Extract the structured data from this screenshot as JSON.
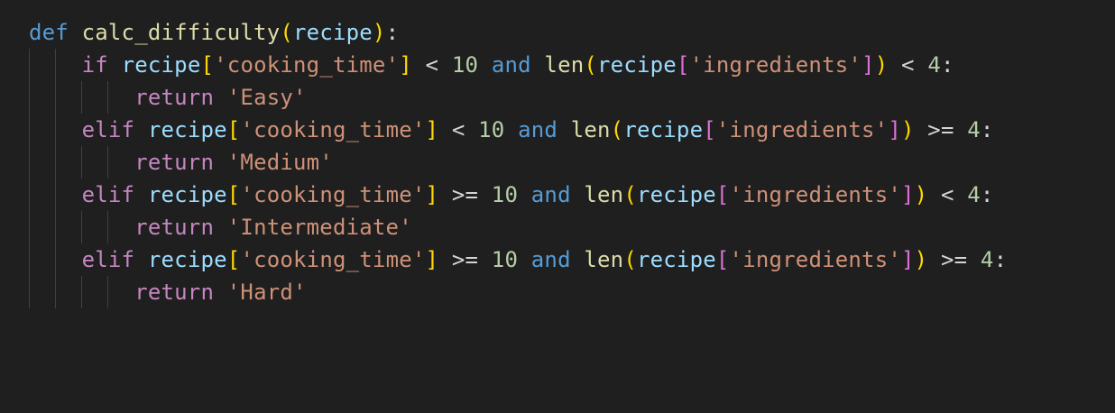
{
  "colors": {
    "background": "#1f1f1f",
    "keyword": "#569cd6",
    "control": "#c586c0",
    "function": "#dcdcaa",
    "variable": "#9cdcfe",
    "string": "#ce9178",
    "number": "#b5cea8",
    "operator": "#d4d4d4",
    "bracket_gold": "#ffd700",
    "bracket_purple": "#da70d6",
    "bracket_blue": "#179fff",
    "indent_guide": "#404040"
  },
  "code_lines": [
    {
      "indent_guides": 0,
      "tokens": [
        {
          "t": "def",
          "c": "keyword"
        },
        {
          "t": " ",
          "c": "operator"
        },
        {
          "t": "calc_difficulty",
          "c": "function"
        },
        {
          "t": "(",
          "c": "bracket_gold"
        },
        {
          "t": "recipe",
          "c": "variable"
        },
        {
          "t": ")",
          "c": "bracket_gold"
        },
        {
          "t": ":",
          "c": "operator"
        }
      ]
    },
    {
      "indent_guides": 2,
      "tokens": [
        {
          "t": "    ",
          "c": "operator"
        },
        {
          "t": "if",
          "c": "control"
        },
        {
          "t": " ",
          "c": "operator"
        },
        {
          "t": "recipe",
          "c": "variable"
        },
        {
          "t": "[",
          "c": "bracket_gold"
        },
        {
          "t": "'cooking_time'",
          "c": "string"
        },
        {
          "t": "]",
          "c": "bracket_gold"
        },
        {
          "t": " < ",
          "c": "operator"
        },
        {
          "t": "10",
          "c": "number"
        },
        {
          "t": " ",
          "c": "operator"
        },
        {
          "t": "and",
          "c": "keyword"
        },
        {
          "t": " ",
          "c": "operator"
        },
        {
          "t": "len",
          "c": "function"
        },
        {
          "t": "(",
          "c": "bracket_gold"
        },
        {
          "t": "recipe",
          "c": "variable"
        },
        {
          "t": "[",
          "c": "bracket_purple"
        },
        {
          "t": "'ingredients'",
          "c": "string"
        },
        {
          "t": "]",
          "c": "bracket_purple"
        },
        {
          "t": ")",
          "c": "bracket_gold"
        },
        {
          "t": " < ",
          "c": "operator"
        },
        {
          "t": "4",
          "c": "number"
        },
        {
          "t": ":",
          "c": "operator"
        }
      ]
    },
    {
      "indent_guides": 4,
      "tokens": [
        {
          "t": "        ",
          "c": "operator"
        },
        {
          "t": "return",
          "c": "control"
        },
        {
          "t": " ",
          "c": "operator"
        },
        {
          "t": "'Easy'",
          "c": "string"
        }
      ]
    },
    {
      "indent_guides": 2,
      "tokens": [
        {
          "t": "    ",
          "c": "operator"
        },
        {
          "t": "elif",
          "c": "control"
        },
        {
          "t": " ",
          "c": "operator"
        },
        {
          "t": "recipe",
          "c": "variable"
        },
        {
          "t": "[",
          "c": "bracket_gold"
        },
        {
          "t": "'cooking_time'",
          "c": "string"
        },
        {
          "t": "]",
          "c": "bracket_gold"
        },
        {
          "t": " < ",
          "c": "operator"
        },
        {
          "t": "10",
          "c": "number"
        },
        {
          "t": " ",
          "c": "operator"
        },
        {
          "t": "and",
          "c": "keyword"
        },
        {
          "t": " ",
          "c": "operator"
        },
        {
          "t": "len",
          "c": "function"
        },
        {
          "t": "(",
          "c": "bracket_gold"
        },
        {
          "t": "recipe",
          "c": "variable"
        },
        {
          "t": "[",
          "c": "bracket_purple"
        },
        {
          "t": "'ingredients'",
          "c": "string"
        },
        {
          "t": "]",
          "c": "bracket_purple"
        },
        {
          "t": ")",
          "c": "bracket_gold"
        },
        {
          "t": " >= ",
          "c": "operator"
        },
        {
          "t": "4",
          "c": "number"
        },
        {
          "t": ":",
          "c": "operator"
        }
      ]
    },
    {
      "indent_guides": 4,
      "tokens": [
        {
          "t": "        ",
          "c": "operator"
        },
        {
          "t": "return",
          "c": "control"
        },
        {
          "t": " ",
          "c": "operator"
        },
        {
          "t": "'Medium'",
          "c": "string"
        }
      ]
    },
    {
      "indent_guides": 2,
      "tokens": [
        {
          "t": "    ",
          "c": "operator"
        },
        {
          "t": "elif",
          "c": "control"
        },
        {
          "t": " ",
          "c": "operator"
        },
        {
          "t": "recipe",
          "c": "variable"
        },
        {
          "t": "[",
          "c": "bracket_gold"
        },
        {
          "t": "'cooking_time'",
          "c": "string"
        },
        {
          "t": "]",
          "c": "bracket_gold"
        },
        {
          "t": " >= ",
          "c": "operator"
        },
        {
          "t": "10",
          "c": "number"
        },
        {
          "t": " ",
          "c": "operator"
        },
        {
          "t": "and",
          "c": "keyword"
        },
        {
          "t": " ",
          "c": "operator"
        },
        {
          "t": "len",
          "c": "function"
        },
        {
          "t": "(",
          "c": "bracket_gold"
        },
        {
          "t": "recipe",
          "c": "variable"
        },
        {
          "t": "[",
          "c": "bracket_purple"
        },
        {
          "t": "'ingredients'",
          "c": "string"
        },
        {
          "t": "]",
          "c": "bracket_purple"
        },
        {
          "t": ")",
          "c": "bracket_gold"
        },
        {
          "t": " < ",
          "c": "operator"
        },
        {
          "t": "4",
          "c": "number"
        },
        {
          "t": ":",
          "c": "operator"
        }
      ]
    },
    {
      "indent_guides": 4,
      "tokens": [
        {
          "t": "        ",
          "c": "operator"
        },
        {
          "t": "return",
          "c": "control"
        },
        {
          "t": " ",
          "c": "operator"
        },
        {
          "t": "'Intermediate'",
          "c": "string"
        }
      ]
    },
    {
      "indent_guides": 2,
      "tokens": [
        {
          "t": "    ",
          "c": "operator"
        },
        {
          "t": "elif",
          "c": "control"
        },
        {
          "t": " ",
          "c": "operator"
        },
        {
          "t": "recipe",
          "c": "variable"
        },
        {
          "t": "[",
          "c": "bracket_gold"
        },
        {
          "t": "'cooking_time'",
          "c": "string"
        },
        {
          "t": "]",
          "c": "bracket_gold"
        },
        {
          "t": " >= ",
          "c": "operator"
        },
        {
          "t": "10",
          "c": "number"
        },
        {
          "t": " ",
          "c": "operator"
        },
        {
          "t": "and",
          "c": "keyword"
        },
        {
          "t": " ",
          "c": "operator"
        },
        {
          "t": "len",
          "c": "function"
        },
        {
          "t": "(",
          "c": "bracket_gold"
        },
        {
          "t": "recipe",
          "c": "variable"
        },
        {
          "t": "[",
          "c": "bracket_purple"
        },
        {
          "t": "'ingredients'",
          "c": "string"
        },
        {
          "t": "]",
          "c": "bracket_purple"
        },
        {
          "t": ")",
          "c": "bracket_gold"
        },
        {
          "t": " >= ",
          "c": "operator"
        },
        {
          "t": "4",
          "c": "number"
        },
        {
          "t": ":",
          "c": "operator"
        }
      ]
    },
    {
      "indent_guides": 4,
      "tokens": [
        {
          "t": "        ",
          "c": "operator"
        },
        {
          "t": "return",
          "c": "control"
        },
        {
          "t": " ",
          "c": "operator"
        },
        {
          "t": "'Hard'",
          "c": "string"
        }
      ]
    }
  ]
}
